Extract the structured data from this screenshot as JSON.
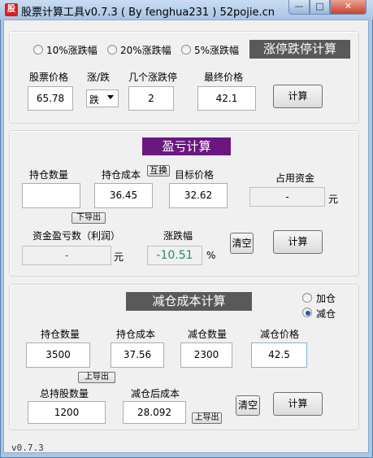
{
  "window": {
    "title": "股票计算工具v0.7.3 ( By fenghua231 ) 52pojie.cn",
    "app_icon": "股",
    "minimize": "—",
    "maximize": "□",
    "close": "✕"
  },
  "limit_section": {
    "radio_10": "10%涨跌幅",
    "radio_20": "20%涨跌幅",
    "radio_5": "5%涨跌幅",
    "banner": "涨停跌停计算",
    "label_price": "股票价格",
    "label_direction": "涨/跌",
    "label_count": "几个涨跌停",
    "label_final": "最终价格",
    "price": "65.78",
    "direction": "跌",
    "count": "2",
    "final": "42.1",
    "calc": "计算"
  },
  "profit_section": {
    "banner": "盈亏计算",
    "label_qty": "持仓数量",
    "label_cost": "持仓成本",
    "swap": "互换",
    "label_target": "目标价格",
    "label_capital": "占用资金",
    "qty": "",
    "cost": "36.45",
    "target": "32.62",
    "capital": "-",
    "capital_unit": "元",
    "export_down": "下导出",
    "label_pnl": "资金盈亏数（利润）",
    "label_change": "涨跌幅",
    "pnl": "-",
    "pnl_unit": "元",
    "change": "-10.51",
    "change_unit": "%",
    "clear": "清空",
    "calc": "计算",
    "pnl_color": "#d02020",
    "change_color": "#2e8b57"
  },
  "reduce_section": {
    "banner": "减仓成本计算",
    "radio_add": "加仓",
    "radio_reduce": "减仓",
    "label_qty": "持仓数量",
    "label_cost": "持仓成本",
    "label_reduce_qty": "减仓数量",
    "label_reduce_price": "减仓价格",
    "qty": "3500",
    "cost": "37.56",
    "reduce_qty": "2300",
    "reduce_price": "42.5",
    "export_up": "上导出",
    "label_total": "总持股数量",
    "label_after_cost": "减仓后成本",
    "total": "1200",
    "after_cost": "28.092",
    "export_up2": "上导出",
    "clear": "清空",
    "calc": "计算"
  },
  "footer": {
    "version": "v0.7.3"
  }
}
